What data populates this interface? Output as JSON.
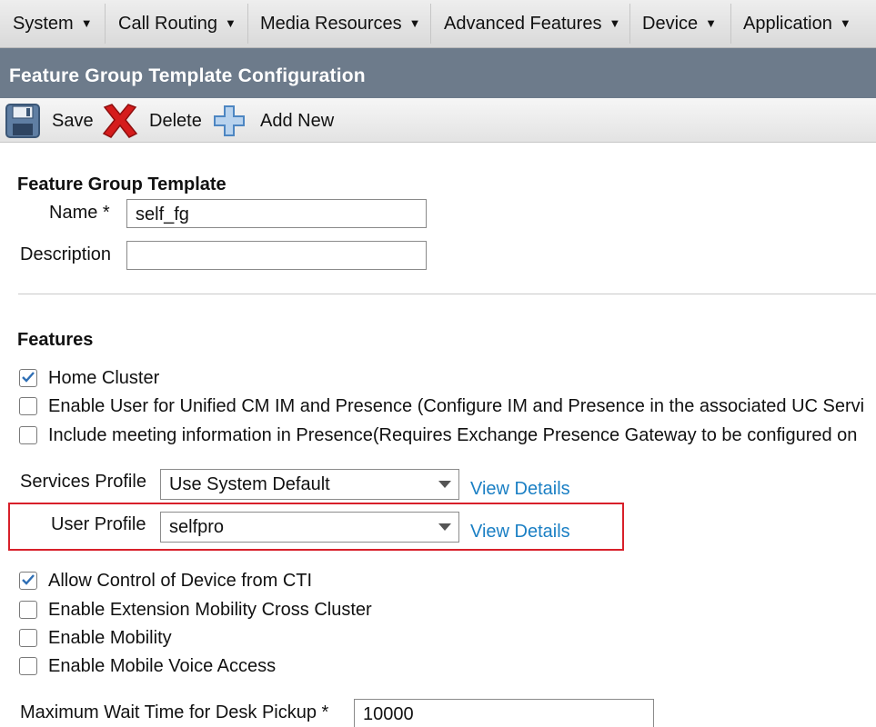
{
  "menu": {
    "items": [
      {
        "label": "System"
      },
      {
        "label": "Call Routing"
      },
      {
        "label": "Media Resources"
      },
      {
        "label": "Advanced Features"
      },
      {
        "label": "Device"
      },
      {
        "label": "Application"
      }
    ],
    "caret_icon": "caret-down-icon"
  },
  "page": {
    "title": "Feature Group Template Configuration"
  },
  "toolbar": {
    "save_label": "Save",
    "delete_label": "Delete",
    "add_new_label": "Add New",
    "save_icon": "floppy-disk-icon",
    "delete_icon": "red-x-icon",
    "add_icon": "plus-icon"
  },
  "template": {
    "heading": "Feature Group Template",
    "name_label": "Name *",
    "name_value": "self_fg",
    "description_label": "Description",
    "description_value": ""
  },
  "features": {
    "heading": "Features",
    "checkboxes_top": [
      {
        "label": "Home Cluster",
        "checked": true
      },
      {
        "label": "Enable User for Unified CM IM and Presence (Configure IM and Presence in the associated UC Servi",
        "checked": false
      },
      {
        "label": "Include meeting information in Presence(Requires Exchange Presence Gateway to be configured on",
        "checked": false
      }
    ],
    "services_profile_label": "Services Profile",
    "services_profile_value": "Use System Default",
    "user_profile_label": "User Profile",
    "user_profile_value": "selfpro",
    "view_details_label": "View Details",
    "checkboxes_bottom": [
      {
        "label": "Allow Control of Device from CTI",
        "checked": true
      },
      {
        "label": "Enable Extension Mobility Cross Cluster",
        "checked": false
      },
      {
        "label": "Enable Mobility",
        "checked": false
      },
      {
        "label": "Enable Mobile Voice Access",
        "checked": false
      }
    ],
    "max_wait_label": "Maximum Wait Time for Desk Pickup *",
    "max_wait_value": "10000"
  },
  "colors": {
    "title_bar": "#6d7b8b",
    "link": "#1a7fc4",
    "highlight_border": "#d8202a",
    "check": "#2f6fb5"
  }
}
